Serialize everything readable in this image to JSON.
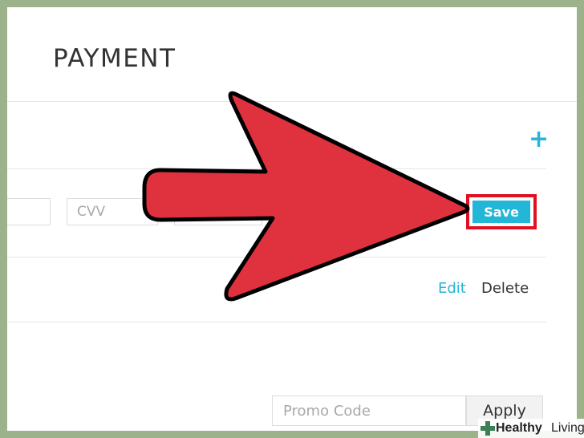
{
  "page": {
    "title": "PAYMENT",
    "add_icon": "plus-icon"
  },
  "card_form": {
    "cvv_placeholder": "CVV",
    "save_label": "Save"
  },
  "saved_card": {
    "edit_label": "Edit",
    "delete_label": "Delete"
  },
  "promo": {
    "placeholder": "Promo Code",
    "apply_label": "Apply"
  },
  "annotation": {
    "arrow_icon": "pointer-arrow-icon",
    "arrow_color": "#e0313f",
    "highlight_color": "#e01020"
  },
  "watermark": {
    "brand_bold": "Healthy",
    "brand_light": "Living"
  },
  "colors": {
    "accent": "#23b6d6",
    "background_frame": "#9cb28a"
  }
}
